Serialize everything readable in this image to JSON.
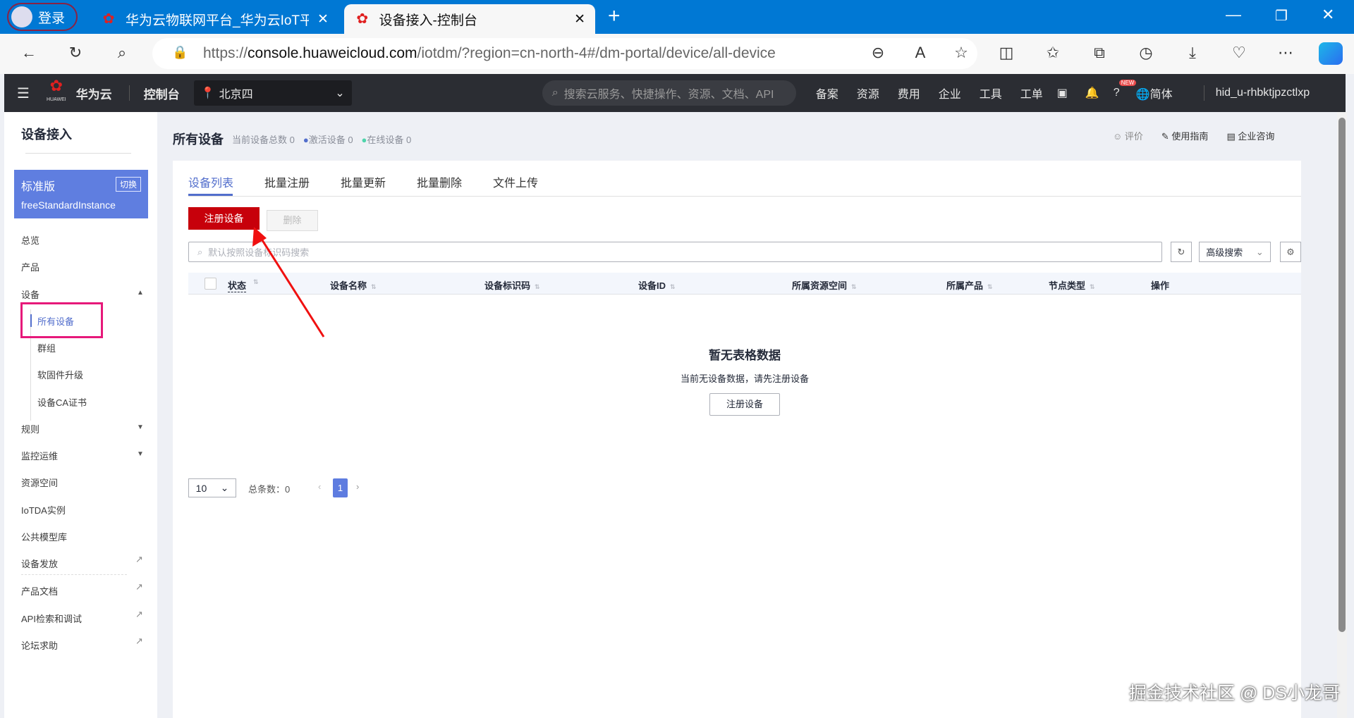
{
  "browser": {
    "login_label": "登录",
    "tabs": [
      {
        "title": "华为云物联网平台_华为云IoT平台"
      },
      {
        "title": "设备接入-控制台"
      }
    ],
    "url_prefix": "https://",
    "url_domain": "console.huaweicloud.com",
    "url_path": "/iotdm/?region=cn-north-4#/dm-portal/device/all-device"
  },
  "topnav": {
    "brand": "华为云",
    "logo_text": "HUAWEI",
    "console": "控制台",
    "region": "北京四",
    "search_placeholder": "搜索云服务、快捷操作、资源、文档、API",
    "links": [
      "备案",
      "资源",
      "费用",
      "企业",
      "工具",
      "工单"
    ],
    "new_badge": "NEW",
    "language": "简体",
    "user": "hid_u-rhbktjpzctlxp"
  },
  "sidebar": {
    "title": "设备接入",
    "instance": {
      "edition": "标准版",
      "switch": "切换",
      "name": "freeStandardInstance"
    },
    "items": [
      "总览",
      "产品",
      "设备",
      "所有设备",
      "群组",
      "软固件升级",
      "设备CA证书",
      "规则",
      "监控运维",
      "资源空间",
      "IoTDA实例",
      "公共模型库",
      "设备发放",
      "产品文档",
      "API检索和调试",
      "论坛求助"
    ]
  },
  "page": {
    "title": "所有设备",
    "total_label": "当前设备总数 0",
    "active_label": "激活设备 0",
    "online_label": "在线设备 0",
    "actions": [
      "评价",
      "使用指南",
      "企业咨询"
    ],
    "tabs": [
      "设备列表",
      "批量注册",
      "批量更新",
      "批量删除",
      "文件上传"
    ],
    "register_button": "注册设备",
    "delete_button": "删除",
    "search_placeholder": "默认按照设备标识码搜索",
    "advanced_search": "高级搜索",
    "columns": [
      "状态",
      "设备名称",
      "设备标识码",
      "设备ID",
      "所属资源空间",
      "所属产品",
      "节点类型",
      "操作"
    ],
    "empty_title": "暂无表格数据",
    "empty_desc": "当前无设备数据，请先注册设备",
    "empty_button": "注册设备",
    "page_size": "10",
    "total_count": "总条数：0",
    "current_page": "1"
  },
  "watermark": "掘金技术社区 @ DS小龙哥",
  "colors": {
    "browser_blue": "#0078d4",
    "accent": "#526ecc",
    "primary_red": "#c7000b",
    "highlight_box": "#e6197a"
  }
}
